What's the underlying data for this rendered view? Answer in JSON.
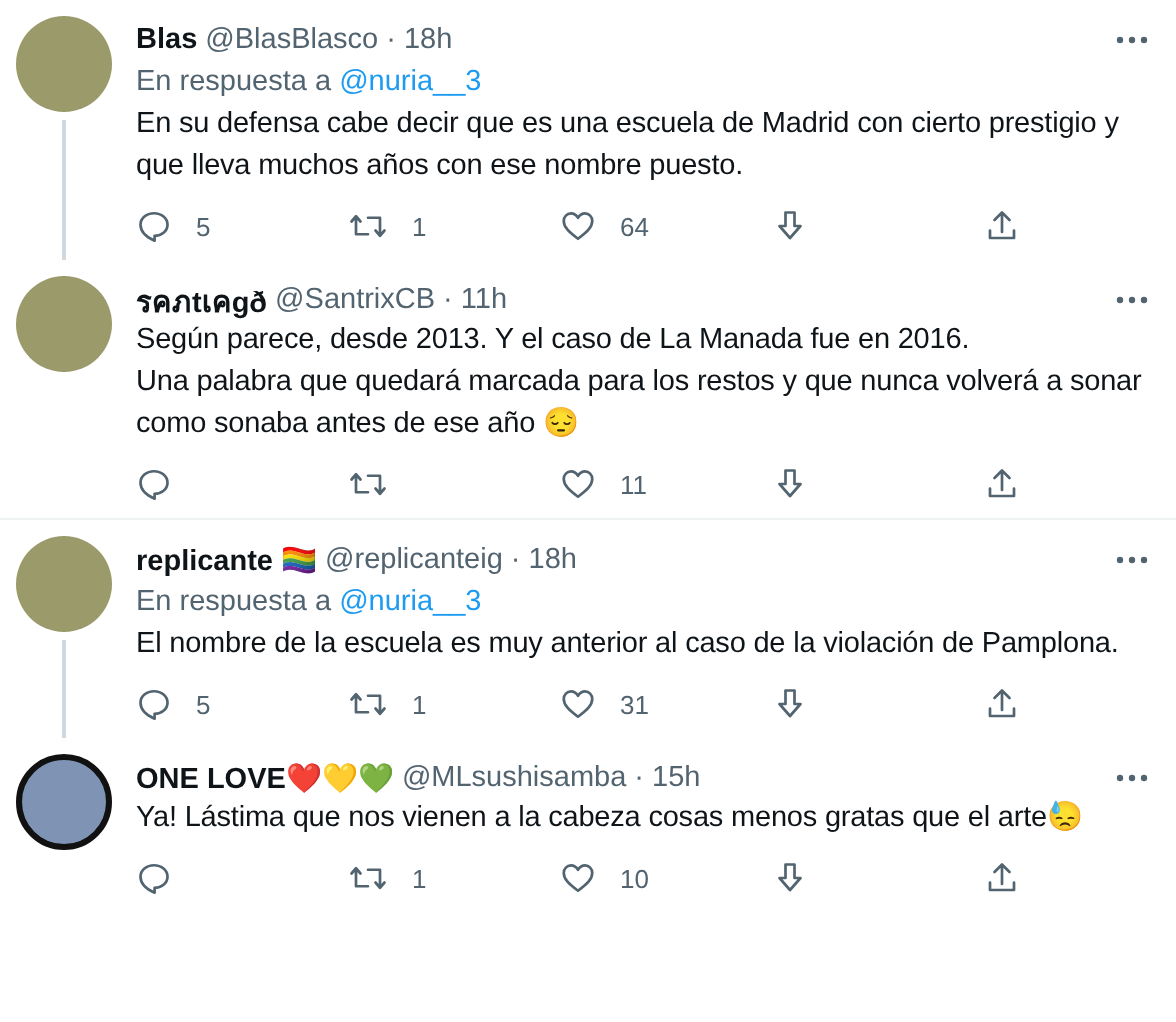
{
  "tweets": [
    {
      "display_name": "Blas",
      "handle": "@BlasBlasco",
      "separator": "·",
      "time": "18h",
      "reply_prefix": "En respuesta a",
      "reply_mention": "@nuria__3",
      "text": "En su defensa cabe decir que es una escuela de Madrid con cierto prestigio y que lleva muchos años con ese nombre puesto.",
      "replies": "5",
      "retweets": "1",
      "likes": "64",
      "thread_continues": true,
      "divider_after": false
    },
    {
      "display_name": "รคภtเคgð",
      "handle": "@SantrixCB",
      "separator": "·",
      "time": "11h",
      "text": "Según parece, desde 2013. Y el caso de La Manada fue en 2016.\nUna palabra que quedará marcada para los restos y que nunca volverá a sonar como sonaba antes de ese año 😔",
      "likes": "11",
      "thread_continues": false,
      "divider_after": true
    },
    {
      "display_name": "replicante 🏳️‍🌈",
      "handle": "@replicanteig",
      "separator": "·",
      "time": "18h",
      "reply_prefix": "En respuesta a",
      "reply_mention": "@nuria__3",
      "text": "El nombre de la escuela es muy anterior al caso de la violación de Pamplona.",
      "replies": "5",
      "retweets": "1",
      "likes": "31",
      "thread_continues": true,
      "divider_after": false
    },
    {
      "display_name": "ONE LOVE❤️💛💚",
      "handle": "@MLsushisamba",
      "separator": "·",
      "time": "15h",
      "text": "Ya! Lástima que nos vienen a la cabeza cosas menos gratas que el arte😓",
      "retweets": "1",
      "likes": "10",
      "thread_continues": false,
      "divider_after": false
    }
  ]
}
